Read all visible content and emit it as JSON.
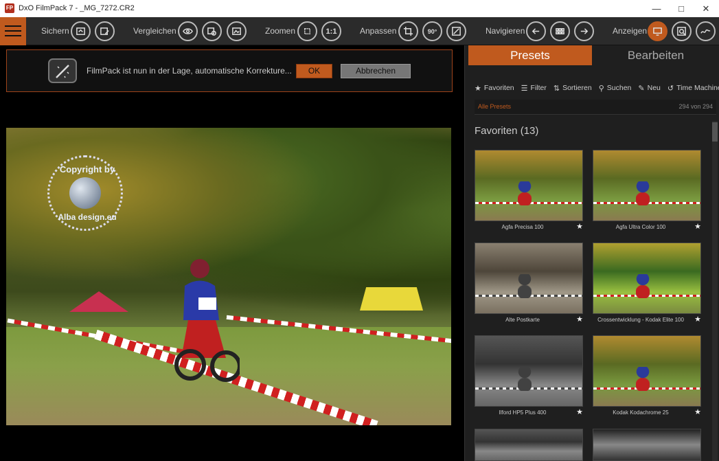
{
  "window": {
    "title": "DxO FilmPack 7 - _MG_7272.CR2",
    "app_icon": "FP"
  },
  "toolbar": {
    "sections": {
      "save": "Sichern",
      "compare": "Vergleichen",
      "zoom": "Zoomen",
      "adjust": "Anpassen",
      "navigate": "Navigieren",
      "display": "Anzeigen"
    },
    "zoom_1to1": "1:1",
    "rotate_90": "90°"
  },
  "notification": {
    "text": "FilmPack ist nun in der Lage, automatische Korrekture...",
    "ok": "OK",
    "cancel": "Abbrechen"
  },
  "watermark": {
    "top": "Copyright by",
    "bottom": "Alba design.eu"
  },
  "panel": {
    "tabs": {
      "presets": "Presets",
      "edit": "Bearbeiten"
    },
    "tools": [
      "Favoriten",
      "Filter",
      "Sortieren",
      "Suchen",
      "Neu",
      "Time Machine"
    ],
    "filter_label": "Alle Presets",
    "filter_count": "294 von 294",
    "favorites_title": "Favoriten (13)",
    "presets": [
      {
        "name": "Agfa Precisa 100",
        "style": "color"
      },
      {
        "name": "Agfa Ultra Color 100",
        "style": "color"
      },
      {
        "name": "Alte Postkarte",
        "style": "sepia"
      },
      {
        "name": "Crossentwicklung - Kodak Elite 100",
        "style": "cross"
      },
      {
        "name": "Ilford HP5 Plus 400",
        "style": "bw"
      },
      {
        "name": "Kodak Kodachrome 25",
        "style": "color"
      }
    ]
  },
  "colors": {
    "accent": "#c05a1e",
    "background": "#000000",
    "panel": "#1f1f1f"
  }
}
